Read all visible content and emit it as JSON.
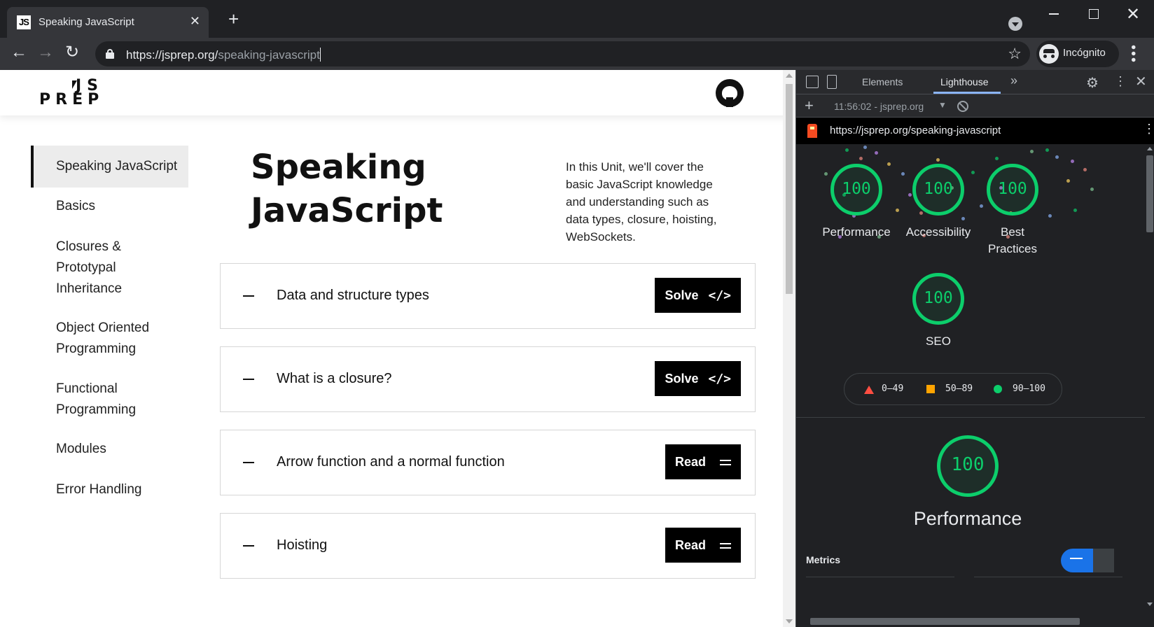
{
  "browser": {
    "tab_title": "Speaking JavaScript",
    "favicon_text": "JS",
    "url_host": "https://jsprep.org/",
    "url_path": "speaking-javascript",
    "profile_label": "Incógnito"
  },
  "site": {
    "logo_line1": "JS",
    "logo_line2": "PREP",
    "sidebar": [
      {
        "label": "Speaking JavaScript",
        "active": true
      },
      {
        "label": "Basics"
      },
      {
        "label": "Closures & Prototypal Inheritance"
      },
      {
        "label": "Object Oriented Programming"
      },
      {
        "label": "Functional Programming"
      },
      {
        "label": "Modules"
      },
      {
        "label": "Error Handling"
      }
    ],
    "title": "Speaking JavaScript",
    "intro": "In this Unit, we'll cover the basic JavaScript knowledge and understanding such as data types, closure, hoisting, WebSockets.",
    "questions": [
      {
        "title": "Data and structure types",
        "button": "Solve",
        "icon": "code-icon"
      },
      {
        "title": "What is a closure?",
        "button": "Solve",
        "icon": "code-icon"
      },
      {
        "title": "Arrow function and a normal function",
        "button": "Read",
        "icon": "menu-icon"
      },
      {
        "title": "Hoisting",
        "button": "Read",
        "icon": "menu-icon"
      }
    ]
  },
  "devtools": {
    "tabs": [
      "Elements",
      "Lighthouse"
    ],
    "active_tab": "Lighthouse",
    "report_label": "11:56:02 - jsprep.org",
    "report_url": "https://jsprep.org/speaking-javascript",
    "categories": [
      {
        "label": "Performance",
        "score": "100"
      },
      {
        "label": "Accessibility",
        "score": "100"
      },
      {
        "label": "Best Practices",
        "score": "100"
      },
      {
        "label": "SEO",
        "score": "100"
      }
    ],
    "legend": [
      {
        "range": "0–49",
        "color": "#ff4e42",
        "shape": "triangle"
      },
      {
        "range": "50–89",
        "color": "#ffa400",
        "shape": "square"
      },
      {
        "range": "90–100",
        "color": "#0cce6b",
        "shape": "circle"
      }
    ],
    "perf_score": "100",
    "perf_label": "Performance",
    "metrics_label": "Metrics"
  },
  "colors": {
    "score_green": "#0cce6b",
    "devtools_accent": "#8ab4f8"
  }
}
